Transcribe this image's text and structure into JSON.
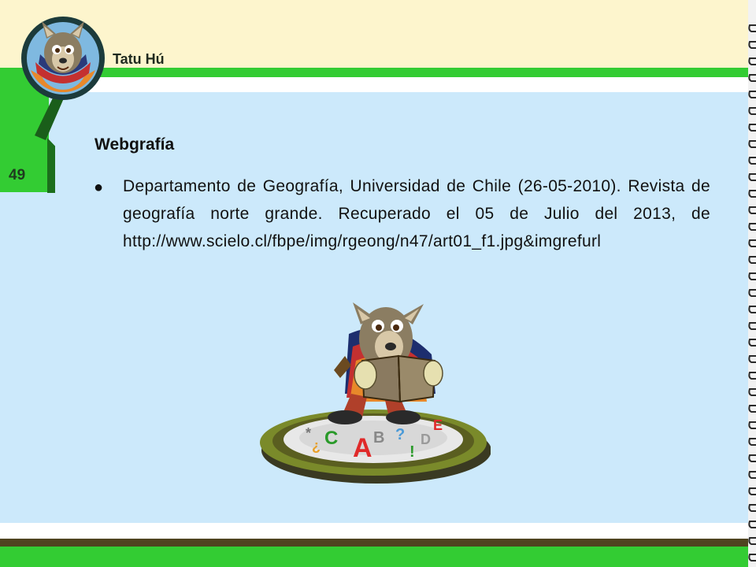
{
  "header": {
    "brand": "Tatu Hú"
  },
  "page": {
    "number": "49"
  },
  "section": {
    "title": "Webgrafía"
  },
  "references": [
    {
      "bullet": "●",
      "text": "Departamento de Geografía, Universidad de Chile (26-05-2010). Revista de geografía norte grande. Recuperado el 05 de Julio del 2013, de http://www.scielo.cl/fbpe/img/rgeong/n47/art01_f1.jpg&imgrefurl"
    }
  ],
  "illustration": {
    "letters": [
      "A",
      "C",
      "B",
      "D",
      "E",
      "?",
      "!",
      "¿",
      "*"
    ],
    "icon": "armadillo-reading-book"
  },
  "colors": {
    "header_band": "#fdf5cd",
    "accent_green": "#33cc33",
    "content_panel": "#cce9fb",
    "bottom_dark": "#4f4420"
  }
}
